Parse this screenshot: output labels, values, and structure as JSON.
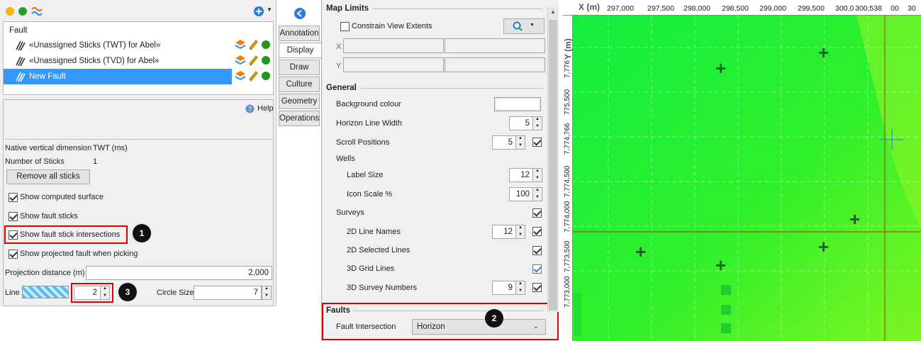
{
  "left_panel": {
    "tree_header": "Fault",
    "items": [
      {
        "label": "«Unassigned Sticks (TWT) for Abel»"
      },
      {
        "label": "«Unassigned Sticks (TVD) for Abel»"
      },
      {
        "label": "New Fault"
      }
    ],
    "help_label": "Help",
    "native_dim_label": "Native vertical dimension",
    "native_dim_value": "TWT (ms)",
    "num_sticks_label": "Number of Sticks",
    "num_sticks_value": "1",
    "remove_button": "Remove all sticks",
    "show_computed": "Show computed surface",
    "show_sticks": "Show fault sticks",
    "show_intersections": "Show fault stick intersections",
    "show_projected": "Show projected fault when picking",
    "projection_label": "Projection distance (m)",
    "projection_value": "2,000",
    "line_label": "Line",
    "line_width": "2",
    "circle_label": "Circle Size",
    "circle_value": "7",
    "badge1": "1",
    "badge3": "3"
  },
  "tabs": [
    "Annotation",
    "Display",
    "Draw",
    "Culture",
    "Geometry",
    "Operations"
  ],
  "settings": {
    "map_limits": "Map Limits",
    "constrain": "Constrain View Extents",
    "x_label": "X",
    "y_label": "Y",
    "general": "General",
    "bg_colour": "Background colour",
    "horizon_width_label": "Horizon Line Width",
    "horizon_width": "5",
    "scroll_label": "Scroll Positions",
    "scroll_value": "5",
    "wells": "Wells",
    "label_size_label": "Label Size",
    "label_size": "12",
    "icon_scale_label": "Icon Scale %",
    "icon_scale": "100",
    "surveys": "Surveys",
    "line_names_label": "2D Line Names",
    "line_names": "12",
    "selected_lines": "2D Selected Lines",
    "grid_lines": "3D Grid Lines",
    "survey_numbers_label": "3D Survey Numbers",
    "survey_numbers": "9",
    "faults": "Faults",
    "fault_intersection_label": "Fault Intersection",
    "fault_intersection_value": "Horizon",
    "badge2": "2"
  },
  "map": {
    "x_axis_title": "X (m)",
    "y_axis_title": "Y (m)",
    "x_ticks": [
      "297,000",
      "297,500",
      "298,000",
      "298,500",
      "299,000",
      "299,500",
      "300,0",
      "300,538",
      "00",
      "30"
    ],
    "y_ticks": [
      "7,776",
      "775,500",
      "7,774,766",
      "7,774,500",
      "7,774,000",
      "7,773,500",
      "7,773,000"
    ],
    "fill_color": "#22ee33",
    "marker_color": "#1d5f2a",
    "crosshair_color": "#d02020"
  }
}
